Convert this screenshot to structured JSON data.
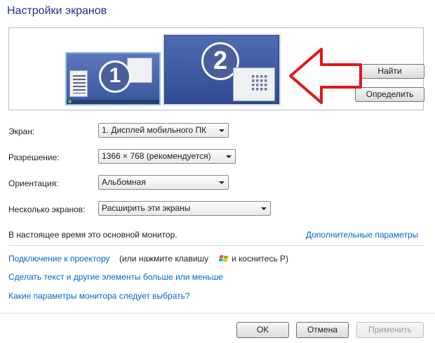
{
  "window": {
    "title": "Настройки экранов"
  },
  "preview": {
    "monitors": [
      {
        "number": "1",
        "icon": "laptop-monitor-icon"
      },
      {
        "number": "2",
        "icon": "external-monitor-icon"
      }
    ],
    "annotation": {
      "icon": "red-arrow-icon",
      "color": "#e0191a"
    }
  },
  "buttons": {
    "find": "Найти",
    "detect": "Определить",
    "ok": "OK",
    "cancel": "Отмена",
    "apply": "Применить"
  },
  "form": {
    "screen_label": "Экран:",
    "screen_value": "1. Дисплей мобильного ПК",
    "resolution_label": "Разрешение:",
    "resolution_value": "1366 × 768 (рекомендуется)",
    "orientation_label": "Ориентация:",
    "orientation_value": "Альбомная",
    "multiple_label": "Несколько экранов:",
    "multiple_value": "Расширить эти экраны"
  },
  "status": {
    "primary_note": "В настоящее время это основной монитор.",
    "advanced_link": "Дополнительные параметры"
  },
  "links": {
    "projector": "Подключение к проектору",
    "projector_hint_before": "(или нажмите клавишу",
    "projector_hint_after": "и коснитесь P)",
    "text_size": "Сделать текст и другие элементы больше или меньше",
    "which_settings": "Какие параметры монитора следует выбрать?"
  },
  "colors": {
    "title": "#1e3287",
    "link": "#0066cc",
    "accent_arrow": "#e0191a"
  }
}
